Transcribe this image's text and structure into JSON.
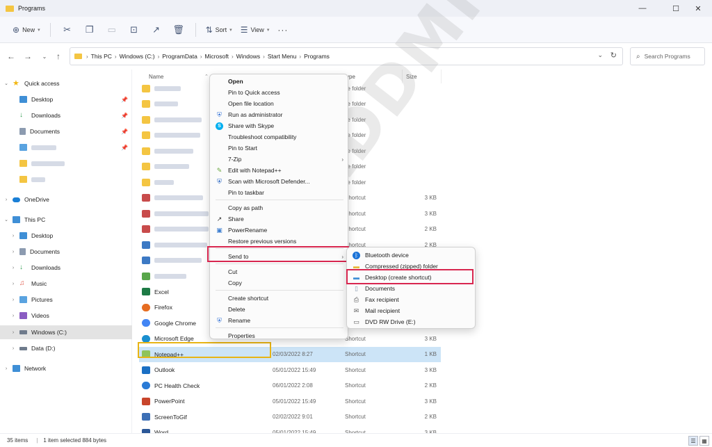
{
  "window": {
    "title": "Programs",
    "controls": [
      "—",
      "☐",
      "✕"
    ]
  },
  "commandbar": {
    "new_label": "New",
    "sort_label": "Sort",
    "view_label": "View",
    "more_label": "···"
  },
  "address": {
    "crumbs": [
      "This PC",
      "Windows (C:)",
      "ProgramData",
      "Microsoft",
      "Windows",
      "Start Menu",
      "Programs"
    ],
    "search_placeholder": "Search Programs"
  },
  "sidebar": {
    "quick_access": "Quick access",
    "quick_items": [
      "Desktop",
      "Downloads",
      "Documents"
    ],
    "onedrive": "OneDrive",
    "this_pc": "This PC",
    "pc_items": [
      "Desktop",
      "Documents",
      "Downloads",
      "Music",
      "Pictures",
      "Videos",
      "Windows (C:)",
      "Data (D:)"
    ],
    "network": "Network"
  },
  "columns": {
    "name": "Name",
    "type": "ype",
    "size": "Size"
  },
  "files": [
    {
      "name": "",
      "type": "ile folder",
      "size": "",
      "icon": "folder"
    },
    {
      "name": "",
      "type": "ile folder",
      "size": "",
      "icon": "folder"
    },
    {
      "name": "",
      "type": "ile folder",
      "size": "",
      "icon": "folder"
    },
    {
      "name": "",
      "type": "ile folder",
      "size": "",
      "icon": "folder"
    },
    {
      "name": "",
      "type": "ile folder",
      "size": "",
      "icon": "folder"
    },
    {
      "name": "",
      "type": "ile folder",
      "size": "",
      "icon": "folder"
    },
    {
      "name": "",
      "type": "ile folder",
      "size": "",
      "icon": "folder"
    },
    {
      "name": "",
      "type": "Shortcut",
      "size": "3 KB",
      "icon": "app-red"
    },
    {
      "name": "",
      "type": "Shortcut",
      "size": "3 KB",
      "icon": "app-red"
    },
    {
      "name": "",
      "type": "Shortcut",
      "size": "2 KB",
      "icon": "app-red"
    },
    {
      "name": "",
      "type": "Shortcut",
      "size": "2 KB",
      "icon": "app-blue"
    },
    {
      "name": "",
      "type": "",
      "size": "",
      "icon": "app-blue"
    },
    {
      "name": "",
      "type": "",
      "size": "",
      "icon": "app-green"
    },
    {
      "name": "Excel",
      "type": "",
      "size": "",
      "icon": "excel"
    },
    {
      "name": "Firefox",
      "type": "",
      "size": "",
      "icon": "firefox"
    },
    {
      "name": "Google Chrome",
      "type": "",
      "size": "",
      "icon": "chrome"
    },
    {
      "name": "Microsoft Edge",
      "type": "Shortcut",
      "size": "3 KB",
      "icon": "edge"
    },
    {
      "name": "Notepad++",
      "date": "02/03/2022 8:27",
      "type": "Shortcut",
      "size": "1 KB",
      "icon": "notepad"
    },
    {
      "name": "Outlook",
      "date": "05/01/2022 15:49",
      "type": "Shortcut",
      "size": "3 KB",
      "icon": "outlook"
    },
    {
      "name": "PC Health Check",
      "date": "06/01/2022 2:08",
      "type": "Shortcut",
      "size": "2 KB",
      "icon": "health"
    },
    {
      "name": "PowerPoint",
      "date": "05/01/2022 15:49",
      "type": "Shortcut",
      "size": "3 KB",
      "icon": "powerpoint"
    },
    {
      "name": "ScreenToGif",
      "date": "02/02/2022 9:01",
      "type": "Shortcut",
      "size": "2 KB",
      "icon": "screentogif"
    },
    {
      "name": "Word",
      "date": "05/01/2022 15:49",
      "type": "Shortcut",
      "size": "3 KB",
      "icon": "word"
    }
  ],
  "context_menu": {
    "items": [
      {
        "label": "Open",
        "bold": true
      },
      {
        "label": "Pin to Quick access"
      },
      {
        "label": "Open file location"
      },
      {
        "label": "Run as administrator",
        "icon": "shield"
      },
      {
        "label": "Share with Skype",
        "icon": "skype"
      },
      {
        "label": "Troubleshoot compatibility"
      },
      {
        "label": "Pin to Start"
      },
      {
        "label": "7-Zip",
        "submenu": true
      },
      {
        "label": "Edit with Notepad++",
        "icon": "notepad"
      },
      {
        "label": "Scan with Microsoft Defender...",
        "icon": "defender"
      },
      {
        "label": "Pin to taskbar"
      },
      {
        "label": "Copy as path"
      },
      {
        "label": "Share",
        "icon": "share"
      },
      {
        "label": "PowerRename",
        "icon": "powerrename"
      },
      {
        "label": "Restore previous versions"
      },
      {
        "label": "Send to",
        "submenu": true
      },
      {
        "label": "Cut"
      },
      {
        "label": "Copy"
      },
      {
        "label": "Create shortcut"
      },
      {
        "label": "Delete"
      },
      {
        "label": "Rename",
        "icon": "shield"
      },
      {
        "label": "Properties"
      }
    ]
  },
  "sendto_menu": {
    "items": [
      {
        "label": "Bluetooth device",
        "icon": "bluetooth"
      },
      {
        "label": "Compressed (zipped) folder",
        "icon": "zip"
      },
      {
        "label": "Desktop (create shortcut)",
        "icon": "desktop"
      },
      {
        "label": "Documents",
        "icon": "documents"
      },
      {
        "label": "Fax recipient",
        "icon": "fax"
      },
      {
        "label": "Mail recipient",
        "icon": "mail"
      },
      {
        "label": "DVD RW Drive (E:)",
        "icon": "dvd"
      }
    ]
  },
  "watermark": "SADDMIN",
  "status": {
    "count": "35 items",
    "selected": "1 item selected  884 bytes"
  },
  "colors": {
    "accent": "#0067c0",
    "selection": "#cce4f7",
    "highlight_yellow": "#e8b414",
    "highlight_pink": "#d8264f",
    "folder": "#f4c542"
  }
}
